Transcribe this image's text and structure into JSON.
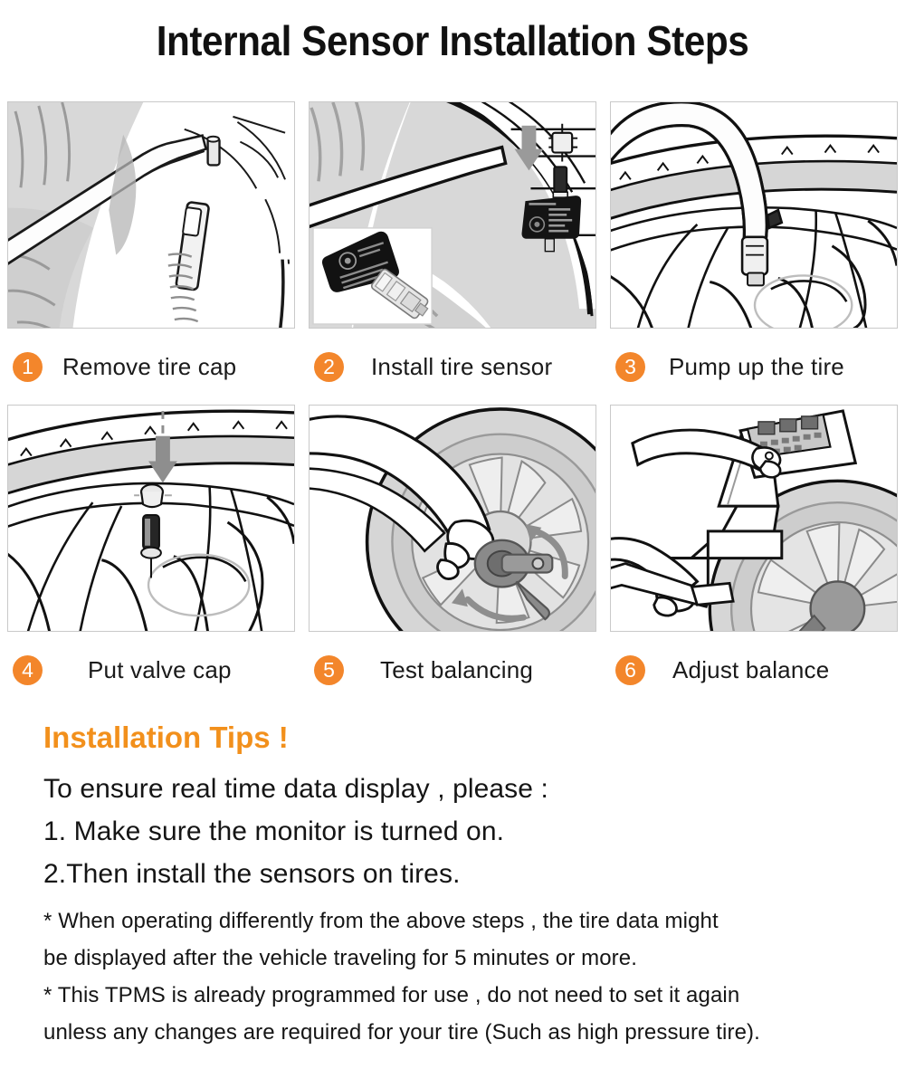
{
  "title": "Internal Sensor Installation Steps",
  "colors": {
    "badge_orange": "#F3862B",
    "tips_orange": "#F2901C",
    "panel_border": "#c9c9c9",
    "text": "#151515",
    "background": "#ffffff"
  },
  "steps": [
    {
      "number": "1",
      "label": "Remove tire cap",
      "illustration": "tire-valve-cap-removal-line-art"
    },
    {
      "number": "2",
      "label": "Install tire sensor",
      "illustration": "tire-sensor-install-line-art-with-sensor-photo-inset"
    },
    {
      "number": "3",
      "label": "Pump up the tire",
      "illustration": "air-pump-hose-on-valve-line-art"
    },
    {
      "number": "4",
      "label": "Put valve cap",
      "illustration": "valve-cap-install-arrow-line-art"
    },
    {
      "number": "5",
      "label": "Test balancing",
      "illustration": "hands-mounting-wheel-on-balancer-line-art"
    },
    {
      "number": "6",
      "label": "Adjust balance",
      "illustration": "balancer-machine-control-panel-line-art"
    }
  ],
  "tips": {
    "heading": "Installation Tips !",
    "lines": [
      "To ensure real time data display , please :",
      "1. Make sure the monitor is turned on.",
      "2.Then install the sensors on tires."
    ],
    "notes": [
      "* When operating differently from the above steps , the tire data might",
      "be displayed after the vehicle traveling for 5 minutes or more.",
      "* This TPMS is already programmed for use , do not need to set it again",
      "unless any changes are required for your tire (Such as high pressure tire)."
    ]
  }
}
